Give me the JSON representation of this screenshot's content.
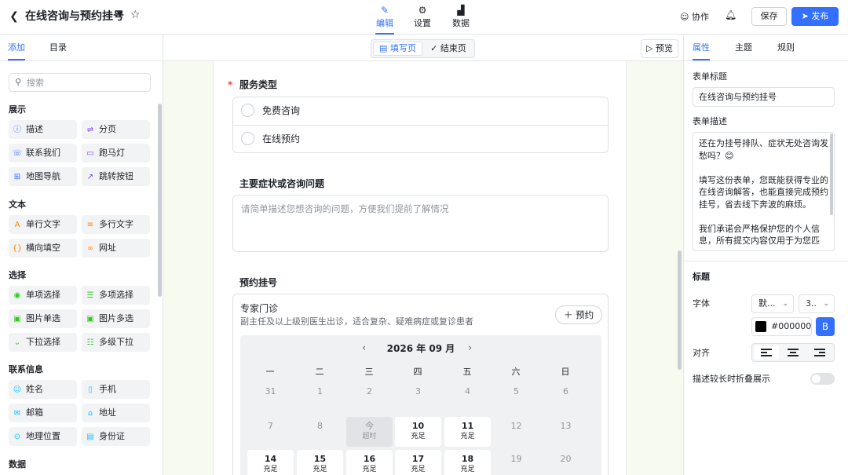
{
  "header": {
    "title": "在线咨询与预约挂号",
    "tabs": [
      {
        "label": "编辑",
        "icon": "pen-icon"
      },
      {
        "label": "设置",
        "icon": "gear-icon"
      },
      {
        "label": "数据",
        "icon": "chart-icon"
      }
    ],
    "collab": "协作",
    "save": "保存",
    "publish": "发布"
  },
  "left": {
    "tabs": [
      "添加",
      "目录"
    ],
    "search_placeholder": "搜索",
    "sections": [
      {
        "title": "展示",
        "items": [
          [
            "描述",
            "分页"
          ],
          [
            "联系我们",
            "跑马灯"
          ],
          [
            "地图导航",
            "跳转按钮"
          ]
        ]
      },
      {
        "title": "文本",
        "items": [
          [
            "单行文字",
            "多行文字"
          ],
          [
            "横向填空",
            "网址"
          ]
        ]
      },
      {
        "title": "选择",
        "items": [
          [
            "单项选择",
            "多项选择"
          ],
          [
            "图片单选",
            "图片多选"
          ],
          [
            "下拉选择",
            "多级下拉"
          ]
        ]
      },
      {
        "title": "联系信息",
        "items": [
          [
            "姓名",
            "手机"
          ],
          [
            "邮箱",
            "地址"
          ],
          [
            "地理位置",
            "身份证"
          ]
        ]
      },
      {
        "title": "数据",
        "items": []
      }
    ]
  },
  "canvas": {
    "seg_fill": "填写页",
    "seg_end": "结束页",
    "preview": "预览",
    "q1": {
      "title": "服务类型",
      "options": [
        "免费咨询",
        "在线预约"
      ]
    },
    "q2": {
      "title": "主要症状或咨询问题",
      "placeholder": "请简单描述您想咨询的问题，方便我们提前了解情况"
    },
    "q3": {
      "title": "预约挂号",
      "clinic": "专家门诊",
      "clinic_desc": "副主任及以上级别医生出诊，适合复杂、疑难病症或复诊患者",
      "book_btn": "预约",
      "month": "2026 年 09 月",
      "weekdays": [
        "一",
        "二",
        "三",
        "四",
        "五",
        "六",
        "日"
      ],
      "days": [
        [
          {
            "d": "31",
            "s": ""
          },
          {
            "d": "1",
            "s": ""
          },
          {
            "d": "2",
            "s": ""
          },
          {
            "d": "3",
            "s": ""
          },
          {
            "d": "4",
            "s": ""
          },
          {
            "d": "5",
            "s": ""
          },
          {
            "d": "6",
            "s": ""
          }
        ],
        [
          {
            "d": "7",
            "s": ""
          },
          {
            "d": "8",
            "s": ""
          },
          {
            "d": "今",
            "s": "超时",
            "today": true
          },
          {
            "d": "10",
            "s": "充足",
            "avail": true
          },
          {
            "d": "11",
            "s": "充足",
            "avail": true
          },
          {
            "d": "12",
            "s": ""
          },
          {
            "d": "13",
            "s": ""
          }
        ],
        [
          {
            "d": "14",
            "s": "充足",
            "avail": true
          },
          {
            "d": "15",
            "s": "充足",
            "avail": true
          },
          {
            "d": "16",
            "s": "充足",
            "avail": true
          },
          {
            "d": "17",
            "s": "充足",
            "avail": true
          },
          {
            "d": "18",
            "s": "充足",
            "avail": true
          },
          {
            "d": "19",
            "s": ""
          },
          {
            "d": "20",
            "s": ""
          }
        ]
      ]
    }
  },
  "right": {
    "tabs": [
      "属性",
      "主题",
      "规则"
    ],
    "form_title_label": "表单标题",
    "form_title_value": "在线咨询与预约挂号",
    "form_desc_label": "表单描述",
    "form_desc_value": "还在为挂号排队、症状无处咨询发愁吗？😊\n\n填写这份表单，您既能获得专业的在线咨询解答，也能直接完成预约挂号，省去线下奔波的麻烦。\n\n我们承诺会严格保护您的个人信息，所有提交内容仅用于为您匹",
    "title_section": "标题",
    "font_label": "字体",
    "font_family": "默...",
    "font_size": "3..",
    "color_value": "#000000",
    "bold": "B",
    "align_label": "对齐",
    "collapse_label": "描述较长时折叠展示"
  }
}
